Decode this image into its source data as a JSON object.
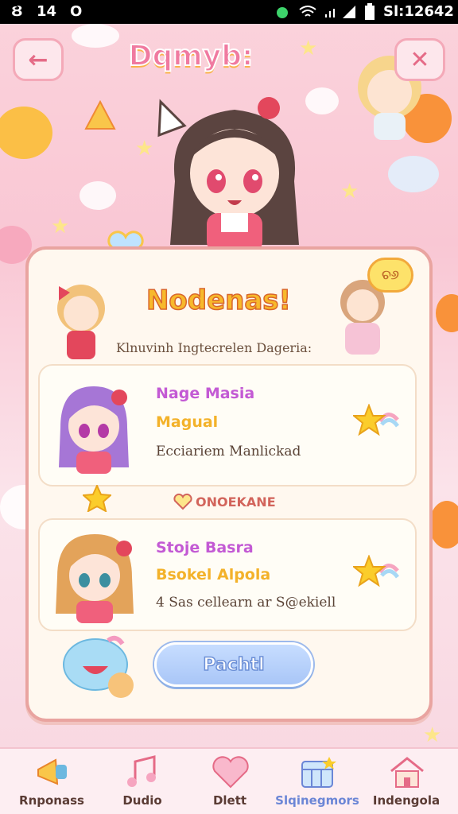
{
  "status_bar": {
    "left_icon": "Ȣ",
    "left_text": "14",
    "left_circle": "O",
    "right_text": "Sl:12642"
  },
  "header": {
    "back_icon": "←",
    "close_icon": "✕",
    "app_title": "Dqmyb:"
  },
  "card": {
    "bubble_text": "ଚ୬",
    "title": "Nodenas!",
    "subtitle": "Klnuvinh Ingtecrelen Dageria:",
    "entries": [
      {
        "name": "Nage Masia",
        "role": "Magual",
        "description": "Ecciariem Manlickad"
      },
      {
        "name": "Stoje Basra",
        "role": "Bsokel Alpola",
        "description": "4 Sas cellearn ar S@ekiell"
      }
    ],
    "section_label": "ONOEKANE",
    "action_button": "Pachtl"
  },
  "bottom_nav": {
    "items": [
      {
        "label": "Rnponass",
        "icon": "megaphone-icon"
      },
      {
        "label": "Dudio",
        "icon": "music-icon"
      },
      {
        "label": "Dlett",
        "icon": "heart-icon"
      },
      {
        "label": "Slqinegmors",
        "icon": "calendar-icon",
        "active": true
      },
      {
        "label": "Indengola",
        "icon": "house-icon"
      }
    ]
  },
  "colors": {
    "accent_pink": "#f07aa0",
    "title_yellow": "#f7b92b",
    "name_purple": "#c35ad4",
    "active_blue": "#6b86d6"
  }
}
